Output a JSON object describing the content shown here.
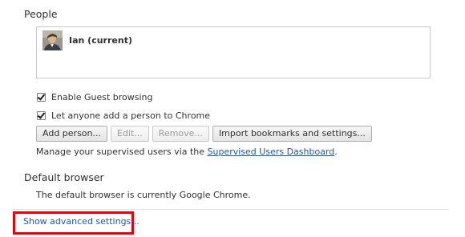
{
  "people": {
    "title": "People",
    "profiles": [
      {
        "name": "Ian (current)"
      }
    ],
    "guest_label": "Enable Guest browsing",
    "guest_checked": true,
    "anyone_label": "Let anyone add a person to Chrome",
    "anyone_checked": true,
    "buttons": {
      "add": "Add person...",
      "edit": "Edit...",
      "remove": "Remove...",
      "import": "Import bookmarks and settings..."
    },
    "manage_prefix": "Manage your supervised users via the ",
    "manage_link": "Supervised Users Dashboard",
    "manage_suffix": "."
  },
  "default_browser": {
    "title": "Default browser",
    "status": "The default browser is currently Google Chrome."
  },
  "advanced": {
    "label": "Show advanced settings...",
    "highlight_color": "#e8000b"
  },
  "colors": {
    "link": "#1a55c4",
    "text": "#303030"
  }
}
